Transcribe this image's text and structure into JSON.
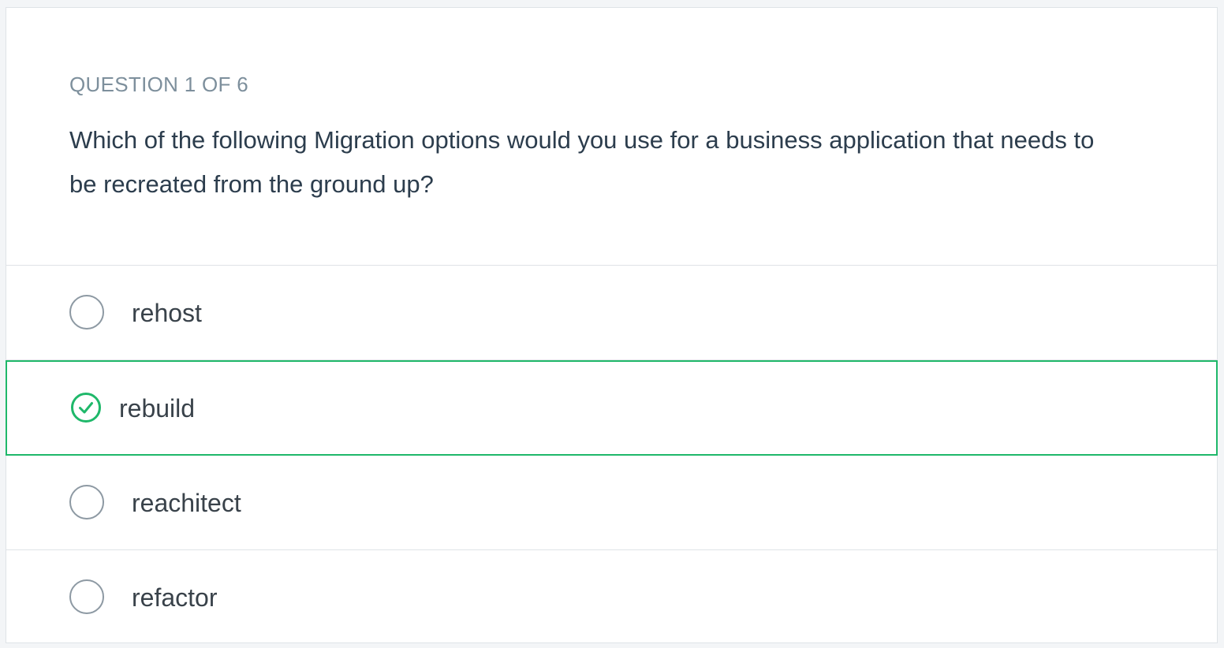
{
  "quiz": {
    "counter": "QUESTION 1 OF 6",
    "question": "Which of the following Migration options would you use for a business application that needs to be recreated from the ground up?",
    "options": [
      {
        "label": "rehost",
        "selected": false
      },
      {
        "label": "rebuild",
        "selected": true
      },
      {
        "label": "reachitect",
        "selected": false
      },
      {
        "label": "refactor",
        "selected": false
      }
    ]
  },
  "colors": {
    "correct": "#1fb86a",
    "border": "#dfe3e7",
    "muted": "#7d8f9c"
  },
  "icons": {
    "selected": "check-circle-icon",
    "unselected": "radio-circle-icon"
  }
}
